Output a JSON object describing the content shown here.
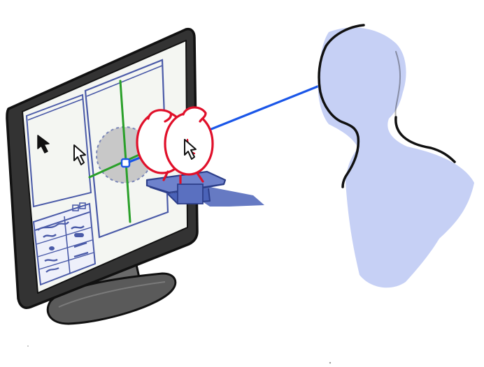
{
  "illustration": {
    "kind": "hand-drawn sketch",
    "colors": {
      "background": "#ffffff",
      "monitor_bezel": "#3a3a3a",
      "monitor_stand": "#555555",
      "screen": "#f4f6f2",
      "ui_panel_lines": "#4a5aa8",
      "axis_vertical": "#2aa02a",
      "axis_horizontal": "#2aa02a",
      "selection_circle": "#c8c8c8",
      "object_outline": "#e0102a",
      "object_base": "#4b63b8",
      "gaze_ray": "#1a56e8",
      "person_fill": "#c6d0f5",
      "person_outline": "#111111"
    },
    "icons": [
      "arrow-cursor-icon",
      "outlined-arrow-cursor-icon",
      "gaze-point-icon",
      "alarm-clock-icon"
    ]
  }
}
